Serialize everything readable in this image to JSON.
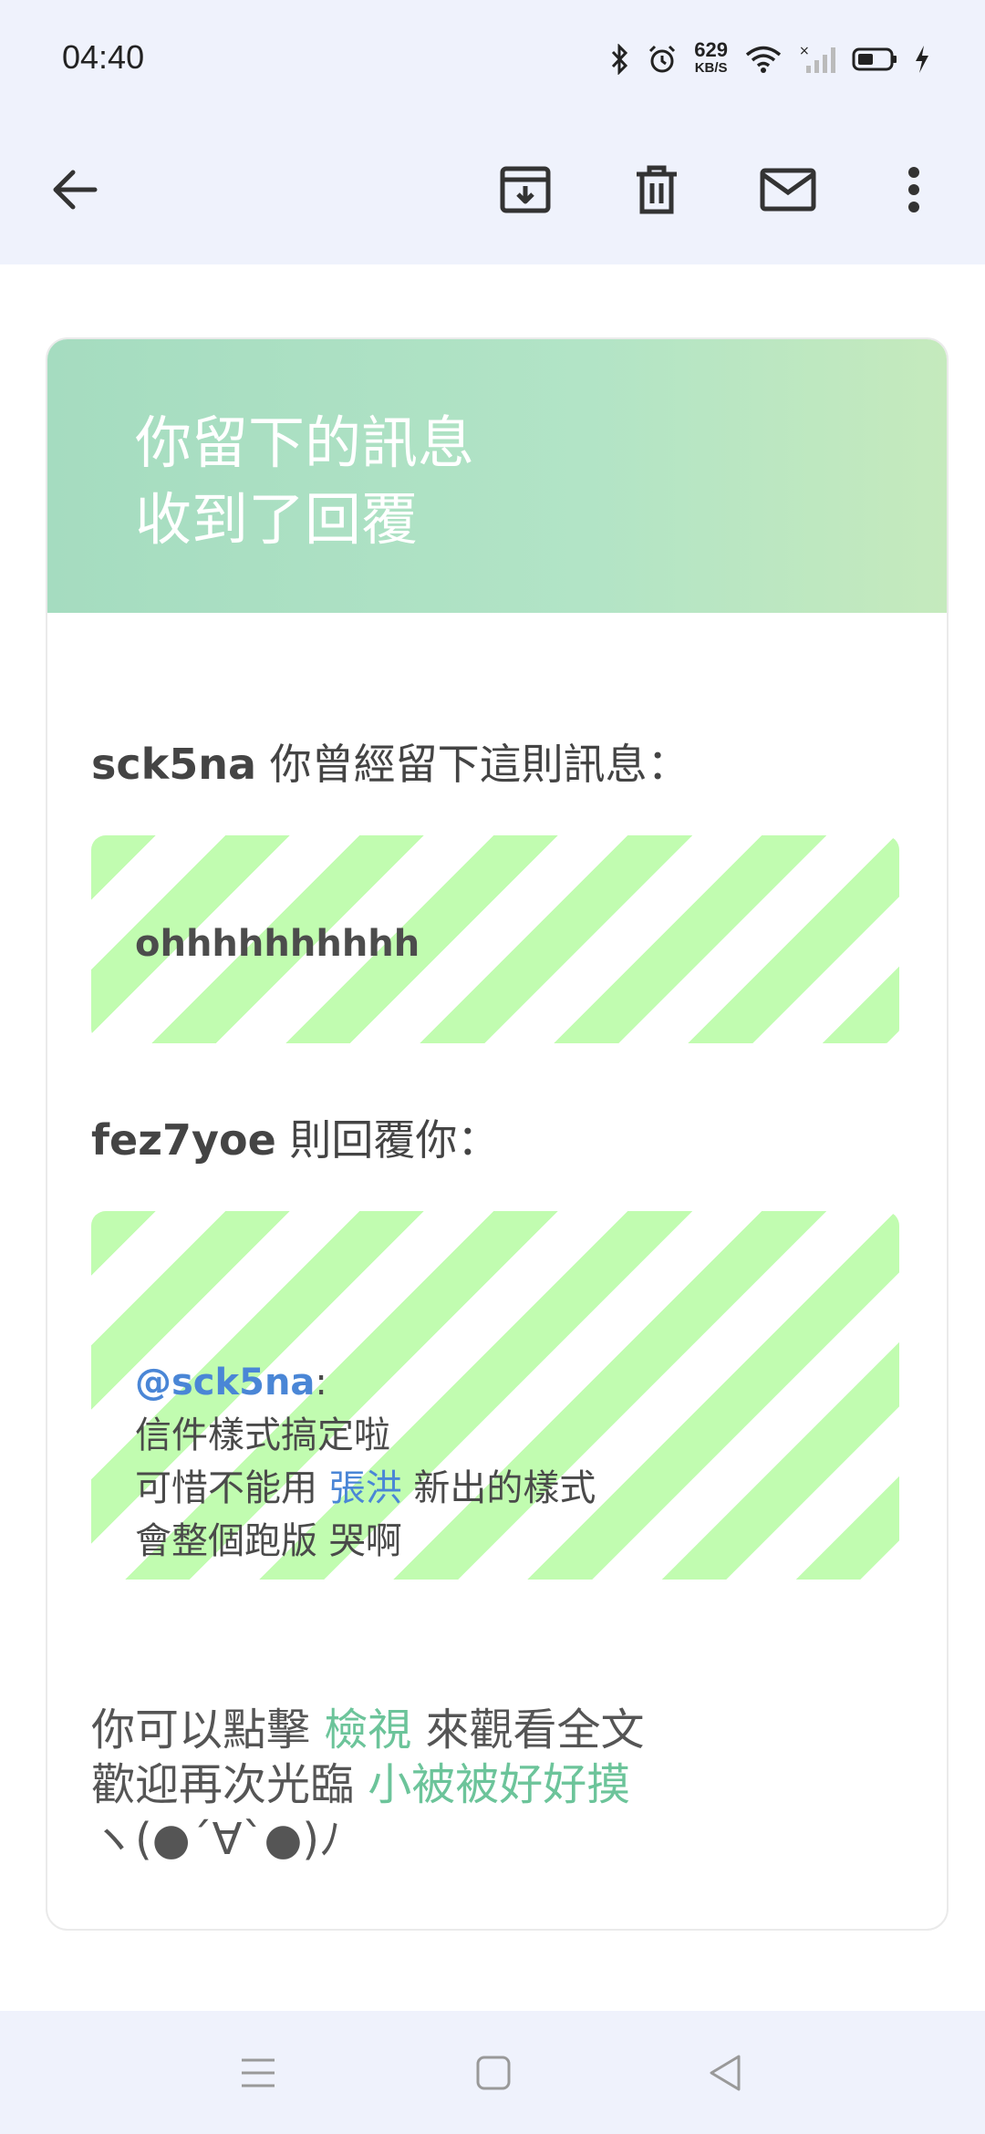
{
  "status_bar": {
    "time": "04:40",
    "net_speed_value": "629",
    "net_speed_unit": "KB/S",
    "icons": [
      "bluetooth-icon",
      "alarm-icon",
      "wifi-icon",
      "signal-icon",
      "battery-icon",
      "charging-icon"
    ]
  },
  "toolbar": {
    "icons": [
      "back-arrow-icon",
      "archive-icon",
      "trash-icon",
      "mail-icon",
      "more-vert-icon"
    ]
  },
  "email": {
    "banner_title": "你留下的訊息\n收到了回覆",
    "sender_name": "sck5na",
    "sender_suffix": " 你曾經留下這則訊息：",
    "original_message": "ohhhhhhhhhh",
    "replier_name": "fez7yoe",
    "replier_suffix": " 則回覆你：",
    "reply": {
      "mention": "@sck5na",
      "mention_suffix": ":",
      "line1": "信件樣式搞定啦",
      "line2_prefix": "可惜不能用 ",
      "line2_link": "張洪",
      "line2_suffix": " 新出的樣式",
      "line3": "會整個跑版 哭啊"
    },
    "footer": {
      "line1_prefix": "你可以點擊 ",
      "line1_link": "檢視",
      "line1_suffix": " 來觀看全文",
      "line2_prefix": "歡迎再次光臨 ",
      "line2_link": "小被被好好摸",
      "line3": "ヽ(●´∀`●)ﾉ"
    }
  },
  "colors": {
    "banner_start": "#a5dcc0",
    "banner_end": "#c5eabd",
    "stripe": "#c1fcb0",
    "mention_blue": "#4a86d6",
    "link_green": "#6cc49a"
  },
  "nav_bar": {
    "icons": [
      "menu-icon",
      "home-square-icon",
      "back-triangle-icon"
    ]
  }
}
